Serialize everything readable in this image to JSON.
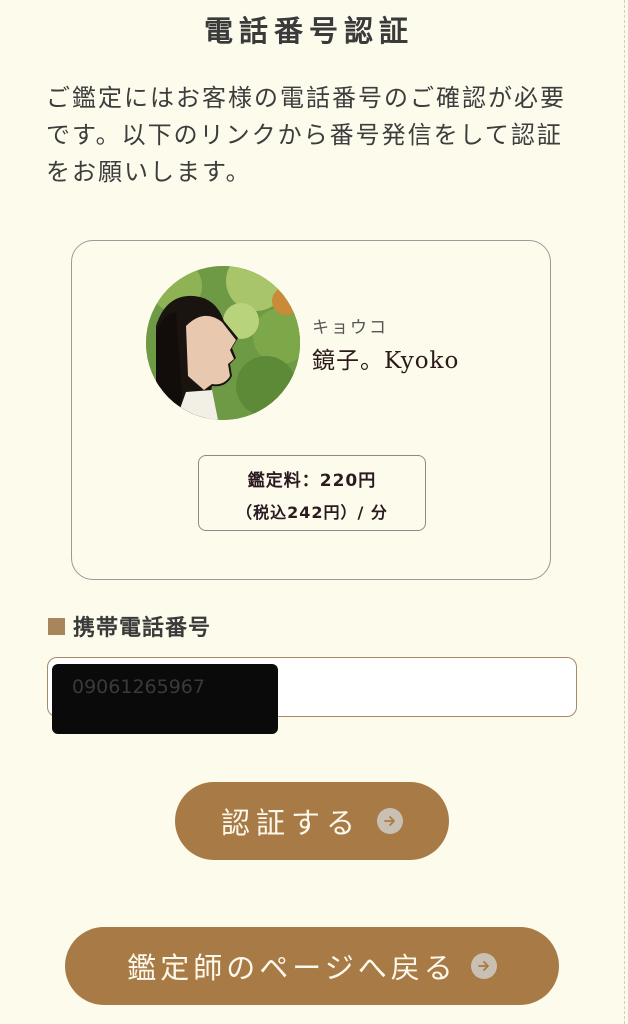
{
  "page": {
    "title": "電話番号認証",
    "intro": "ご鑑定にはお客様の電話番号のご確認が必要です。以下のリンクから番号発信をして認証をお願いします。"
  },
  "advisor": {
    "name_kana": "キョウコ",
    "name": "鏡子。Kyoko",
    "price_line1": "鑑定料：220円",
    "price_line2": "（税込242円）/ 分"
  },
  "form": {
    "phone_label": "携帯電話番号",
    "phone_value": "09061265967"
  },
  "buttons": {
    "verify_label": "認証する",
    "back_label": "鑑定師のページへ戻る"
  },
  "colors": {
    "background": "#fdfbec",
    "accent": "#a87a45",
    "label_square": "#a6865a"
  },
  "icons": {
    "verify_arrow": "arrow-right-circle-icon",
    "back_arrow": "arrow-right-circle-icon"
  }
}
